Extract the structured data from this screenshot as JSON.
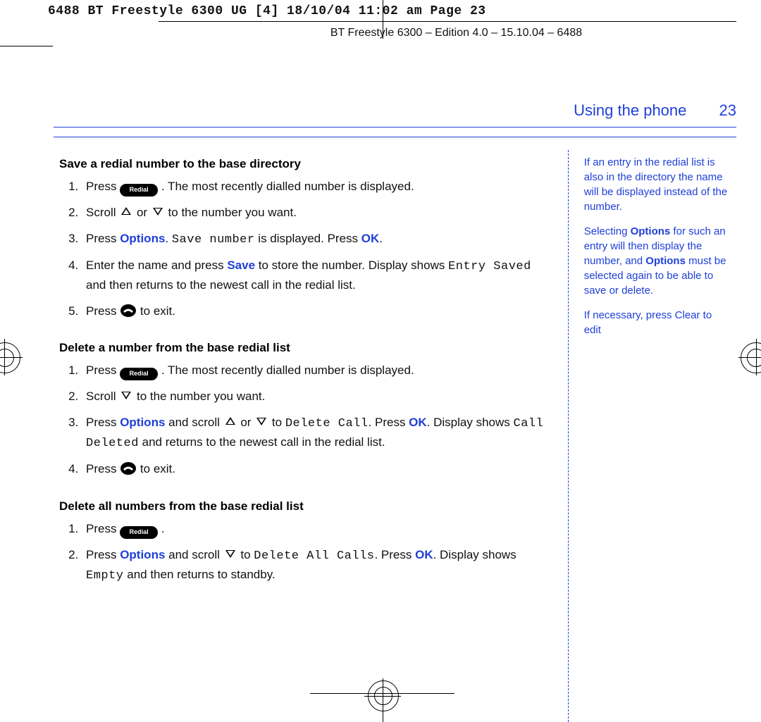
{
  "meta": {
    "header_line": "6488 BT Freestyle 6300 UG [4]  18/10/04  11:02 am  Page 23",
    "subheader": "BT Freestyle 6300 – Edition 4.0 – 15.10.04 – 6488"
  },
  "page": {
    "section_title": "Using the phone",
    "number": "23"
  },
  "keys": {
    "redial": "Redial"
  },
  "left": {
    "save": {
      "heading": "Save a redial number to the base directory",
      "s1_a": "Press ",
      "s1_b": ". The most recently dialled number is displayed.",
      "s2_a": "Scroll ",
      "s2_or": " or ",
      "s2_b": " to the number you want.",
      "s3_a": "Press ",
      "s3_options": "Options",
      "s3_b": ". ",
      "s3_lcd": "Save number",
      "s3_c": " is displayed. Press ",
      "s3_ok": "OK",
      "s3_d": ".",
      "s4_a": "Enter the name and press ",
      "s4_save": "Save",
      "s4_b": " to store the number. Display shows ",
      "s4_lcd": "Entry Saved",
      "s4_c": " and then returns to the newest call in the redial list.",
      "s5_a": "Press ",
      "s5_b": " to exit."
    },
    "delone": {
      "heading": "Delete a number from the base redial list",
      "s1_a": "Press ",
      "s1_b": ". The most recently dialled number is displayed.",
      "s2_a": "Scroll ",
      "s2_b": " to the number you want.",
      "s3_a": "Press ",
      "s3_options": "Options",
      "s3_b": " and scroll ",
      "s3_or": " or ",
      "s3_c": " to ",
      "s3_lcd1": "Delete Call",
      "s3_d": ". Press ",
      "s3_ok": "OK",
      "s3_e": ". Display shows ",
      "s3_lcd2": "Call Deleted",
      "s3_f": " and returns to the newest call in the redial list.",
      "s4_a": "Press ",
      "s4_b": " to exit."
    },
    "delall": {
      "heading": "Delete all numbers from the base redial list",
      "s1_a": "Press ",
      "s1_b": ".",
      "s2_a": "Press ",
      "s2_options": "Options",
      "s2_b": " and scroll ",
      "s2_c": " to ",
      "s2_lcd1": "Delete All Calls",
      "s2_d": ". Press ",
      "s2_ok": "OK",
      "s2_e": ". Display shows ",
      "s2_lcd2": "Empty",
      "s2_f": " and then returns to standby."
    }
  },
  "right": {
    "note1_a": "If an entry in the redial list is also in the directory the name will be displayed instead of the number.",
    "note2_a": "Selecting ",
    "note2_b": "Options",
    "note2_c": " for such an entry will then display the number, and ",
    "note2_d": "Options",
    "note2_e": " must be selected again to be able to save or delete.",
    "note3": "If necessary, press Clear to edit"
  }
}
